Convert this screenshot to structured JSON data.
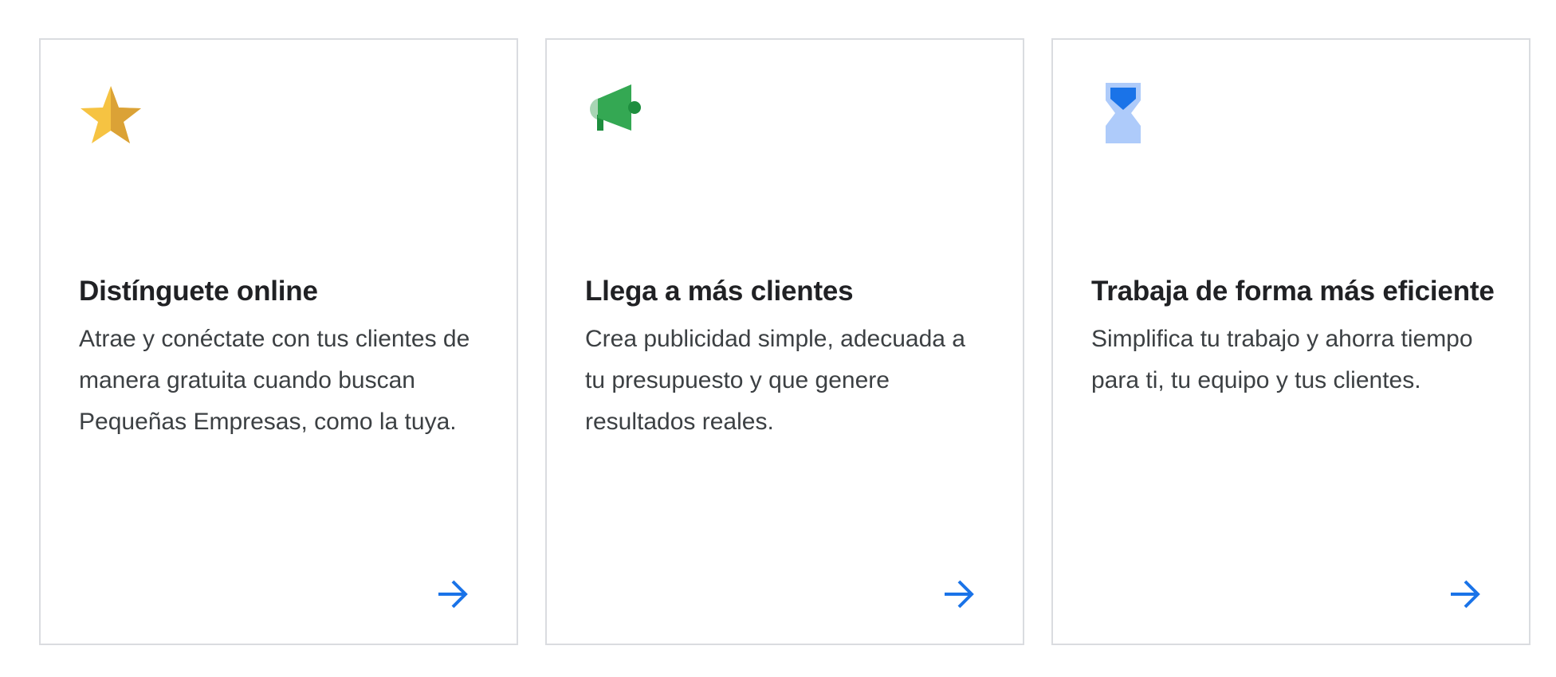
{
  "cards": [
    {
      "icon": "star-icon",
      "title": "Distínguete online",
      "body": "Atrae y conéctate con tus clientes de manera gratuita cuando buscan Pequeñas Empresas, como la tuya.",
      "arrow_icon": "arrow-forward-icon"
    },
    {
      "icon": "megaphone-icon",
      "title": "Llega a más clientes",
      "body": "Crea publicidad simple, adecuada a tu presupuesto y que genere resultados reales.",
      "arrow_icon": "arrow-forward-icon"
    },
    {
      "icon": "hourglass-icon",
      "title": "Trabaja de forma más eficiente",
      "body": "Simplifica tu trabajo y ahorra tiempo para ti, tu equipo y tus clientes.",
      "arrow_icon": "arrow-forward-icon"
    }
  ],
  "colors": {
    "card_border": "#dadce0",
    "title_text": "#202124",
    "body_text": "#3c4043",
    "arrow": "#1a73e8",
    "star_light": "#f6c342",
    "star_dark": "#dba236",
    "megaphone_green": "#34a853",
    "megaphone_light": "#a8d5b4",
    "megaphone_dark": "#1e8e3e",
    "hourglass_blue": "#1a73e8",
    "hourglass_light": "#aecbfa"
  }
}
